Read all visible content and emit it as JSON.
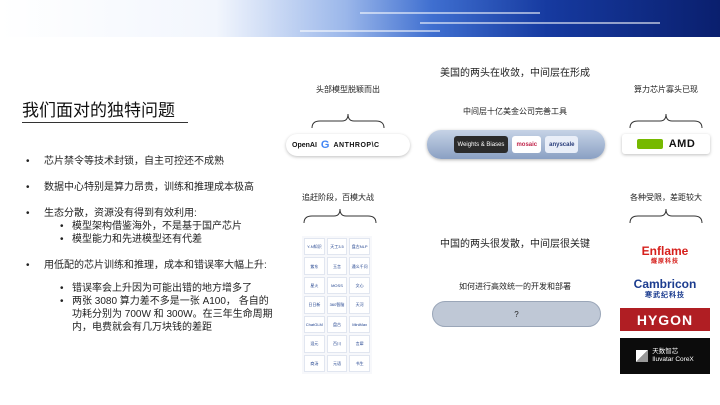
{
  "slide": {
    "title": "我们面对的独特问题"
  },
  "bullets": [
    {
      "text": "芯片禁令等技术封锁，自主可控还不成熟"
    },
    {
      "text": "数据中心特别是算力昂贵，训练和推理成本极高"
    },
    {
      "text": "生态分散，资源没有得到有效利用:",
      "sub": [
        "模型架构借鉴海外，不是基于国产芯片",
        "模型能力和先进模型还有代差"
      ]
    },
    {
      "text": "用低配的芯片训练和推理，成本和错误率大幅上升:",
      "sub": [
        "错误率会上升因为可能出错的地方增多了",
        "两张 3080 算力差不多是一张 A100， 各自的功耗分别为 700W 和 300W。在三年生命周期内，电费就会有几万块钱的差距"
      ]
    }
  ],
  "diagram": {
    "us_heading": "美国的两头在收敛，中间层在形成",
    "cn_heading": "中国的两头很发散，中间层很关键",
    "top_models_label": "头部模型脱颖而出",
    "middle_label": "中间层十亿美金公司完善工具",
    "chip_label": "算力芯片寡头已现",
    "chase_label": "追赶阶段，百模大战",
    "constraint_label": "各种受限，差距较大",
    "question_label": "如何进行高效统一的开发和部署",
    "question_mark": "?",
    "us_models": [
      "OpenAI",
      "G",
      "ANTHROP\\C"
    ],
    "us_tools": [
      "Weights & Biases",
      "mosaic",
      "anyscale"
    ],
    "us_chips": [
      "AMD"
    ],
    "cn_vendors": {
      "enflame": "Enflame",
      "enflame_cn": "燧原科技",
      "cambricon": "Cambricon",
      "cambricon_cn": "寒武纪科技",
      "hygon": "HYGON",
      "iluvatar_cn": "天数智芯",
      "iluvatar": "Iluvatar CoreX"
    },
    "cn_model_grid": [
      "Y-N知识",
      "天工3.5",
      "盘古NLP",
      "紫东",
      "玉言",
      "通义千问",
      "星火",
      "MOSS",
      "文心",
      "日日新",
      "360智脑",
      "天河",
      "ChatGLM",
      "盘古",
      "MiniMax",
      "混元",
      "百川",
      "言犀",
      "商汤",
      "元语",
      "书生"
    ]
  },
  "colors": {
    "banner_dark": "#0a1f6e",
    "hygon_red": "#b01e23",
    "enflame_red": "#d6201c",
    "cambricon_blue": "#1b3c8f",
    "nvidia_green": "#76b900"
  }
}
